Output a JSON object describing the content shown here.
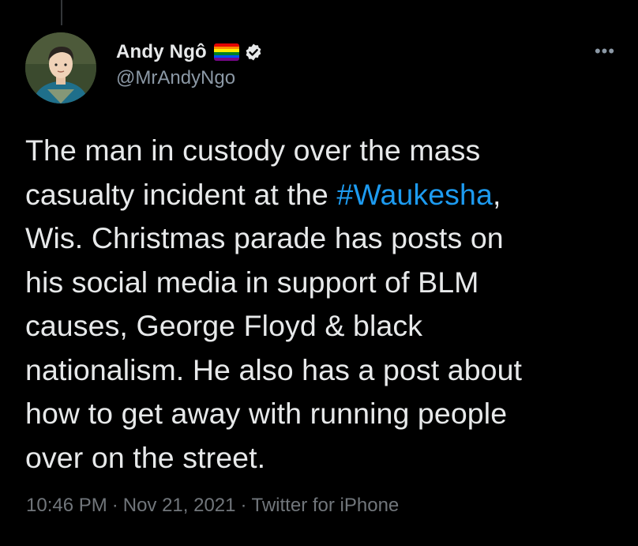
{
  "author": {
    "display_name": "Andy Ngô",
    "handle": "@MrAndyNgo",
    "flag_icon": "rainbow-flag-icon",
    "verified_icon": "verified-badge-icon",
    "flag_colors": [
      "#e40303",
      "#ff8c00",
      "#ffed00",
      "#008026",
      "#004dff",
      "#750787"
    ],
    "verified_color": "#e7e9ea"
  },
  "more_icon": "more-options-icon",
  "tweet": {
    "lines": [
      [
        "The man in custody over the mass"
      ],
      [
        "casualty incident at the ",
        "#Waukesha",
        ","
      ],
      [
        "Wis. Christmas parade has posts on"
      ],
      [
        "his social media in support of BLM"
      ],
      [
        "causes, George Floyd & black"
      ],
      [
        "nationalism. He also has a post about"
      ],
      [
        "how to get away with running people"
      ],
      [
        "over on the street."
      ]
    ],
    "hashtag": "#Waukesha",
    "hashtag_color": "#1d9bf0"
  },
  "meta": {
    "time": "10:46 PM",
    "separator": "·",
    "date": "Nov 21, 2021",
    "source": "Twitter for iPhone"
  }
}
